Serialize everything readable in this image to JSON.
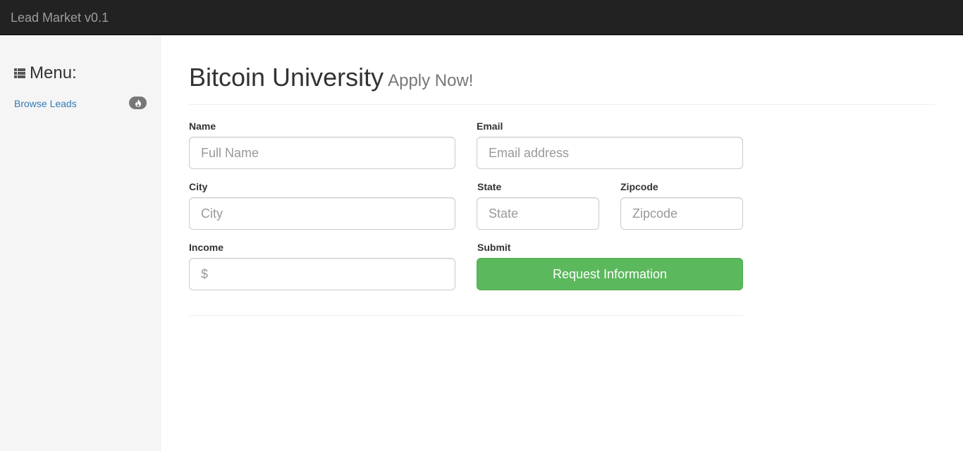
{
  "navbar": {
    "brand": "Lead Market v0.1"
  },
  "sidebar": {
    "menu_icon": "list-icon",
    "menu_heading": "Menu:",
    "items": [
      {
        "label": "Browse Leads",
        "badge_icon": "fire-icon"
      }
    ]
  },
  "header": {
    "title": "Bitcoin University",
    "subtitle": "Apply Now!"
  },
  "form": {
    "name": {
      "label": "Name",
      "placeholder": "Full Name"
    },
    "email": {
      "label": "Email",
      "placeholder": "Email address"
    },
    "city": {
      "label": "City",
      "placeholder": "City"
    },
    "state": {
      "label": "State",
      "placeholder": "State"
    },
    "zipcode": {
      "label": "Zipcode",
      "placeholder": "Zipcode"
    },
    "income": {
      "label": "Income",
      "placeholder": "$"
    },
    "submit": {
      "label": "Submit",
      "button_label": "Request Information"
    }
  },
  "colors": {
    "navbar_bg": "#222222",
    "link": "#337ab7",
    "success": "#5cb85c"
  }
}
